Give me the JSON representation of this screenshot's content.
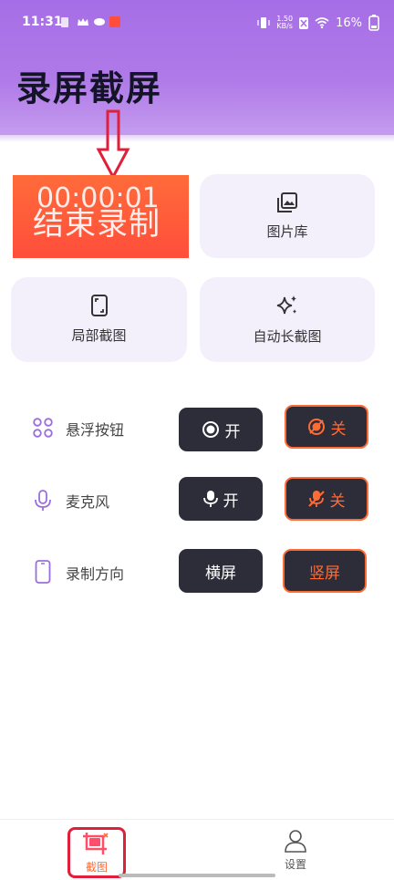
{
  "status_bar": {
    "time": "11:31",
    "net_speed": "1.50\nKB/s",
    "battery": "16%"
  },
  "page_title": "录屏截屏",
  "record": {
    "timer": "00:00:01",
    "stop_label": "结束录制"
  },
  "cards": {
    "gallery": "图片库",
    "partial": "局部截图",
    "long": "自动长截图"
  },
  "settings": {
    "float": {
      "label": "悬浮按钮",
      "on": "开",
      "off": "关"
    },
    "mic": {
      "label": "麦克风",
      "on": "开",
      "off": "关"
    },
    "orientation": {
      "label": "录制方向",
      "landscape": "横屏",
      "portrait": "竖屏"
    }
  },
  "tabs": {
    "screenshot": "截图",
    "settings": "设置"
  },
  "colors": {
    "accent": "#ff6b35",
    "header": "#a66ee6",
    "dark_button": "#2d2d3a",
    "icon_purple": "#9b6ee0"
  }
}
